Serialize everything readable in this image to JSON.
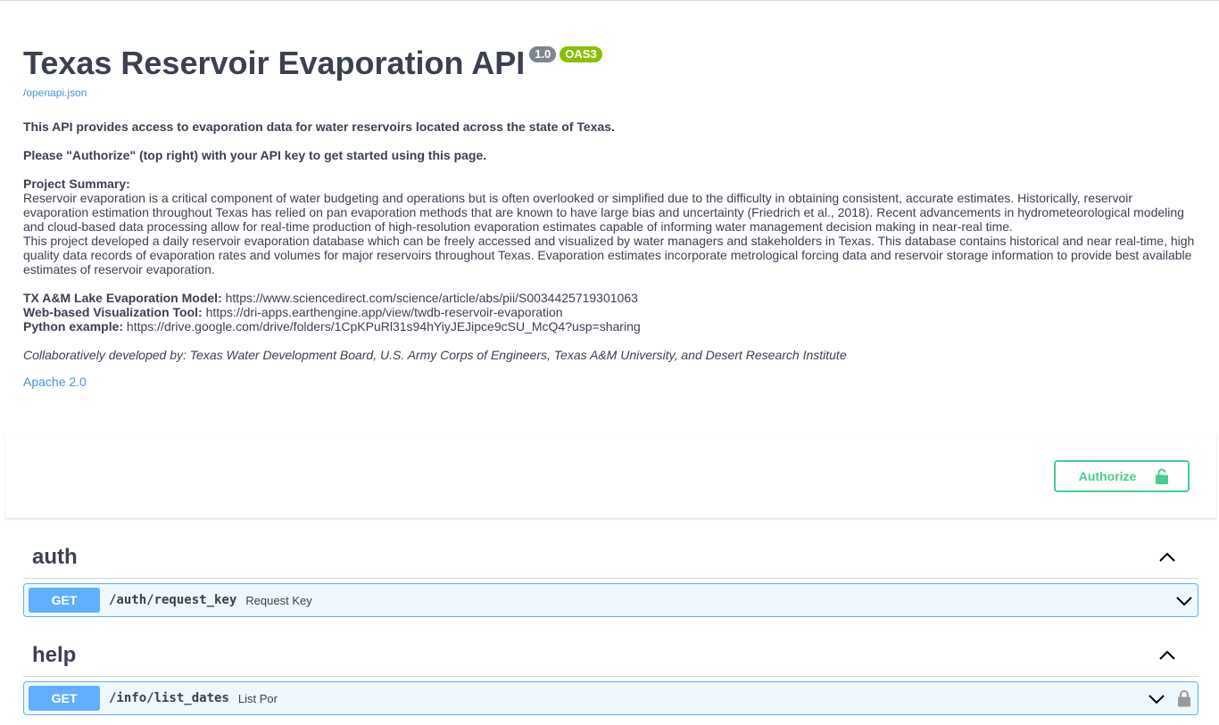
{
  "info": {
    "title": "Texas Reservoir Evaporation API",
    "version_badge": "1.0",
    "oas_badge": "OAS3",
    "openapi_link": "/openapi.json",
    "desc_line1": "This API provides access to evaporation data for water reservoirs located across the state of Texas.",
    "desc_line2": "Please \"Authorize\" (top right) with your API key to get started using this page.",
    "summary_heading": "Project Summary:",
    "summary_p1": "Reservoir evaporation is a critical component of water budgeting and operations but is often overlooked or simplified due to the difficulty in obtaining consistent, accurate estimates. Historically, reservoir evaporation estimation throughout Texas has relied on pan evaporation methods that are known to have large bias and uncertainty (Friedrich et al., 2018). Recent advancements in hydrometeorological modeling and cloud-based data processing allow for real-time production of high-resolution evaporation estimates capable of informing water management decision making in near-real time.",
    "summary_p2": "This project developed a daily reservoir evaporation database which can be freely accessed and visualized by water managers and stakeholders in Texas. This database contains historical and near real-time, high quality data records of evaporation rates and volumes for major reservoirs throughout Texas. Evaporation estimates incorporate metrological forcing data and reservoir storage information to provide best available estimates of reservoir evaporation.",
    "links": [
      {
        "label": "TX A&M Lake Evaporation Model:",
        "url": "https://www.sciencedirect.com/science/article/abs/pii/S0034425719301063"
      },
      {
        "label": "Web-based Visualization Tool:",
        "url": "https://dri-apps.earthengine.app/view/twdb-reservoir-evaporation"
      },
      {
        "label": "Python example:",
        "url": "https://drive.google.com/drive/folders/1CpKPuRl31s94hYiyJEJipce9cSU_McQ4?usp=sharing"
      }
    ],
    "credits": "Collaboratively developed by: Texas Water Development Board, U.S. Army Corps of Engineers, Texas A&M University, and Desert Research Institute",
    "license": "Apache 2.0"
  },
  "authorize": {
    "label": "Authorize",
    "icon": "unlocked-icon"
  },
  "tags": [
    {
      "name": "auth",
      "operations": [
        {
          "method": "GET",
          "path": "/auth/request_key",
          "summary": "Request Key",
          "locked": false
        }
      ]
    },
    {
      "name": "help",
      "operations": [
        {
          "method": "GET",
          "path": "/info/list_dates",
          "summary": "List Por",
          "locked": true
        }
      ]
    }
  ],
  "colors": {
    "get_method": "#61affe",
    "authorize": "#49cc90",
    "oas_badge": "#89bf04",
    "version_badge": "#7d8492",
    "link": "#4990e2"
  }
}
